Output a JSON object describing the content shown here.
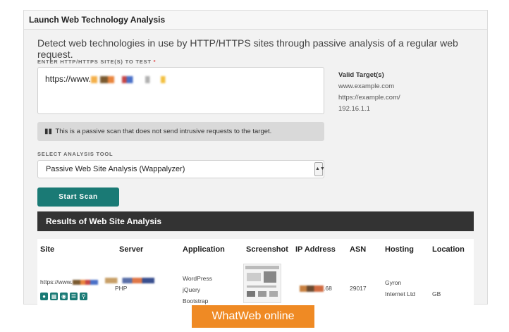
{
  "panel": {
    "title": "Launch Web Technology Analysis",
    "intro": "Detect web technologies in use by HTTP/HTTPS sites through passive analysis of a regular web request."
  },
  "form": {
    "url_label": "ENTER HTTP/HTTPS SITE(S) TO TEST",
    "required_mark": "*",
    "url_prefix": "https://www.",
    "valid_targets": {
      "title": "Valid Target(s)",
      "items": [
        "www.example.com",
        "https://example.com/",
        "192.16.1.1"
      ]
    },
    "note": "This is a passive scan that does not send intrusive requests to the target.",
    "tool_label": "SELECT ANALYSIS TOOL",
    "tool_selected": "Passive Web Site Analysis (Wappalyzer)",
    "scan_button": "Start Scan"
  },
  "results": {
    "title": "Results of Web Site Analysis",
    "columns": [
      "Site",
      "Server",
      "Application",
      "Screenshot",
      "IP Address",
      "ASN",
      "Hosting",
      "Location"
    ],
    "row": {
      "site": "https://www.",
      "server": "PHP",
      "applications": [
        "WordPress",
        "jQuery",
        "Bootstrap"
      ],
      "ip_suffix": ".68",
      "asn": "29017",
      "hosting": [
        "Gyron",
        "Internet Ltd"
      ],
      "location": "GB"
    }
  },
  "badge": "WhatWeb online",
  "colors": {
    "accent": "#1a7a75",
    "results_bar": "#333333",
    "badge": "#ef8a24"
  }
}
